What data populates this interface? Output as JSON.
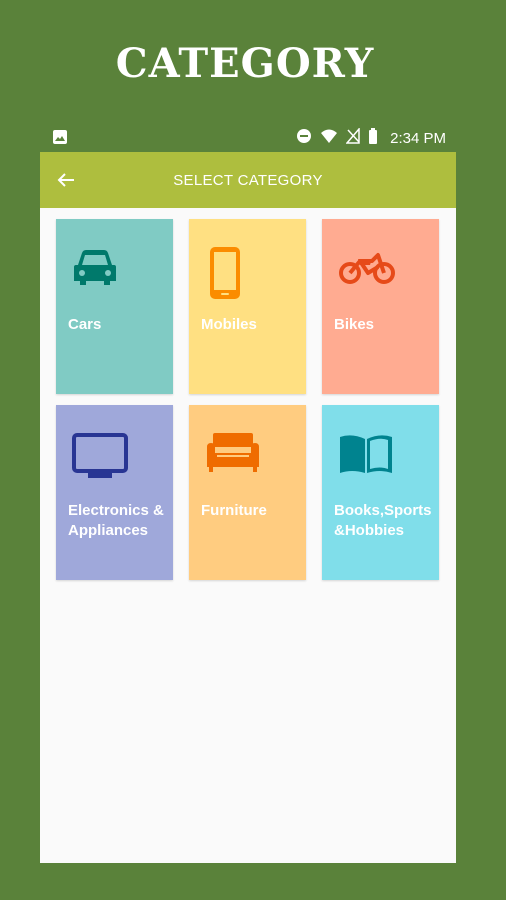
{
  "banner": {
    "title": "CATEGORY"
  },
  "status_bar": {
    "time": "2:34 PM"
  },
  "app_bar": {
    "title": "SELECT CATEGORY"
  },
  "categories": [
    {
      "label": "Cars",
      "icon": "car-icon",
      "bg": "#80cbc4",
      "icon_color": "#00796b"
    },
    {
      "label": "Mobiles",
      "icon": "mobile-phone-icon",
      "bg": "#ffe082",
      "icon_color": "#fb8c00"
    },
    {
      "label": "Bikes",
      "icon": "motorbike-icon",
      "bg": "#ffab91",
      "icon_color": "#e64a19"
    },
    {
      "label": "Electronics &\nAppliances",
      "icon": "tv-icon",
      "bg": "#9fa8da",
      "icon_color": "#283593"
    },
    {
      "label": "Furniture",
      "icon": "sofa-icon",
      "bg": "#ffcc80",
      "icon_color": "#ef6c00"
    },
    {
      "label": "Books,Sports\n&Hobbies",
      "icon": "book-icon",
      "bg": "#80deea",
      "icon_color": "#00838f"
    }
  ]
}
